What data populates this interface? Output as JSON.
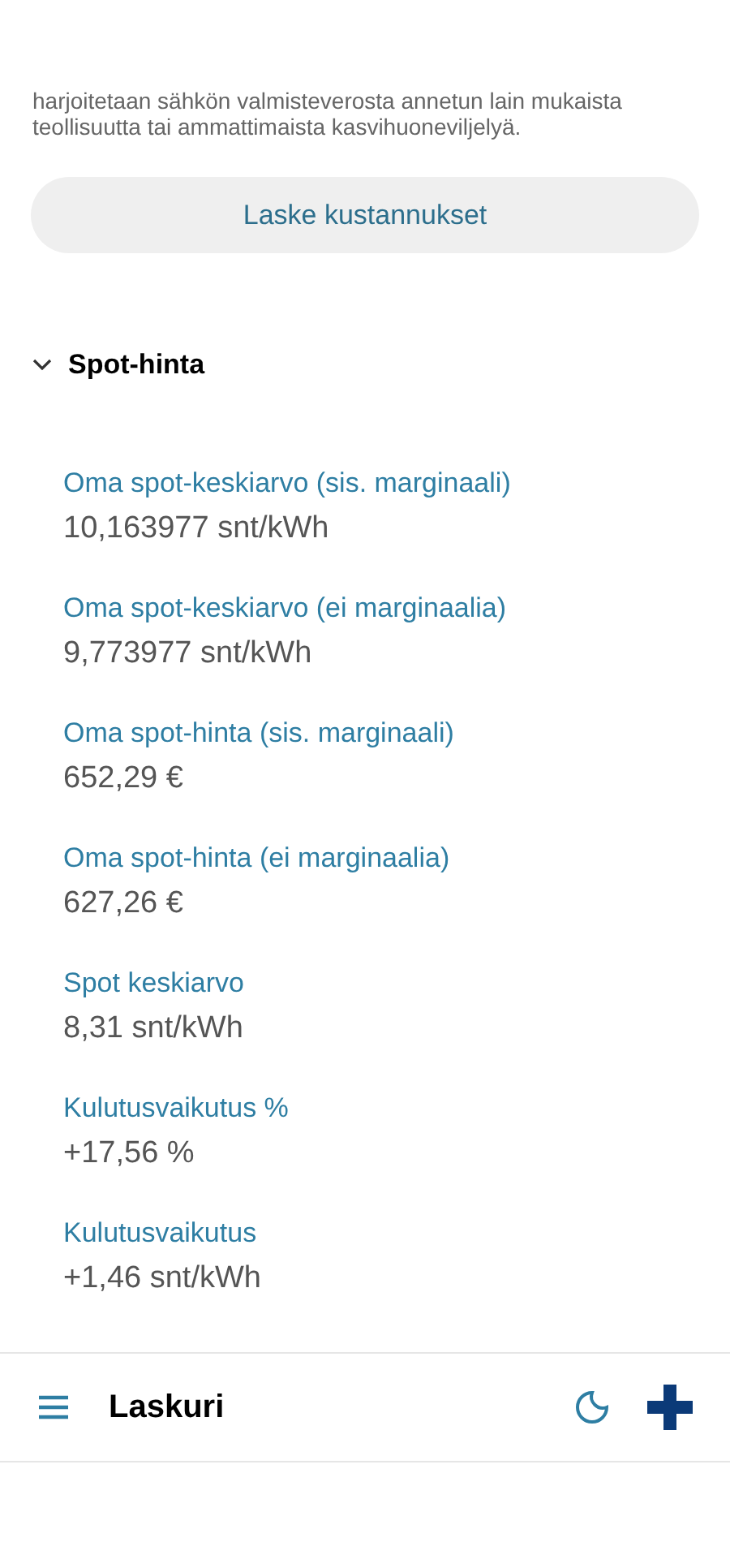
{
  "intro_text": "harjoitetaan sähkön valmisteverosta annetun lain mukaista teollisuutta tai ammattimaista kasvihuoneviljelyä.",
  "calculate_button": "Laske kustannukset",
  "section": {
    "title": "Spot-hinta",
    "expanded": true,
    "items": [
      {
        "label": "Oma spot-keskiarvo (sis. marginaali)",
        "value": "10,163977 snt/kWh"
      },
      {
        "label": "Oma spot-keskiarvo (ei marginaalia)",
        "value": "9,773977 snt/kWh"
      },
      {
        "label": "Oma spot-hinta (sis. marginaali)",
        "value": "652,29 €"
      },
      {
        "label": "Oma spot-hinta (ei marginaalia)",
        "value": "627,26 €"
      },
      {
        "label": "Spot keskiarvo",
        "value": "8,31 snt/kWh"
      },
      {
        "label": "Kulutusvaikutus %",
        "value": "+17,56 %"
      },
      {
        "label": "Kulutusvaikutus",
        "value": "+1,46 snt/kWh"
      }
    ]
  },
  "bottom_bar": {
    "title": "Laskuri"
  }
}
